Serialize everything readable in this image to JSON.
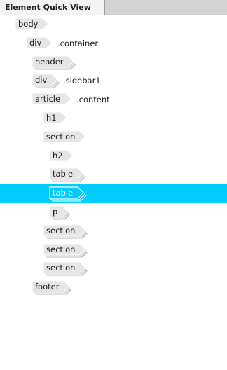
{
  "panel": {
    "tab_title": "Element Quick View"
  },
  "tree": {
    "nodes": [
      {
        "tag": "body",
        "selector": "",
        "depth": 0,
        "stack": false,
        "selected": false
      },
      {
        "tag": "div",
        "selector": ".container",
        "depth": 1,
        "stack": false,
        "selected": false
      },
      {
        "tag": "header",
        "selector": "",
        "depth": 2,
        "stack": true,
        "selected": false
      },
      {
        "tag": "div",
        "selector": ".sidebar1",
        "depth": 2,
        "stack": true,
        "selected": false
      },
      {
        "tag": "article",
        "selector": ".content",
        "depth": 2,
        "stack": false,
        "selected": false
      },
      {
        "tag": "h1",
        "selector": "",
        "depth": 3,
        "stack": false,
        "selected": false
      },
      {
        "tag": "section",
        "selector": "",
        "depth": 3,
        "stack": false,
        "selected": false
      },
      {
        "tag": "h2",
        "selector": "",
        "depth": 4,
        "stack": false,
        "selected": false
      },
      {
        "tag": "table",
        "selector": "",
        "depth": 4,
        "stack": true,
        "selected": false
      },
      {
        "tag": "table",
        "selector": "",
        "depth": 4,
        "stack": true,
        "selected": true
      },
      {
        "tag": "p",
        "selector": "",
        "depth": 4,
        "stack": true,
        "selected": false
      },
      {
        "tag": "section",
        "selector": "",
        "depth": 3,
        "stack": true,
        "selected": false
      },
      {
        "tag": "section",
        "selector": "",
        "depth": 3,
        "stack": true,
        "selected": false
      },
      {
        "tag": "section",
        "selector": "",
        "depth": 3,
        "stack": true,
        "selected": false
      },
      {
        "tag": "footer",
        "selector": "",
        "depth": 2,
        "stack": true,
        "selected": false
      }
    ]
  },
  "colors": {
    "tag_fill": "#e6e6e6",
    "tag_stack_1": "#d0d0d0",
    "tag_stack_2": "#bdbdbd",
    "selected_row": "#00ccff",
    "selected_tag_fill": "#00ccff",
    "selected_tag_stroke": "#ffffff"
  }
}
